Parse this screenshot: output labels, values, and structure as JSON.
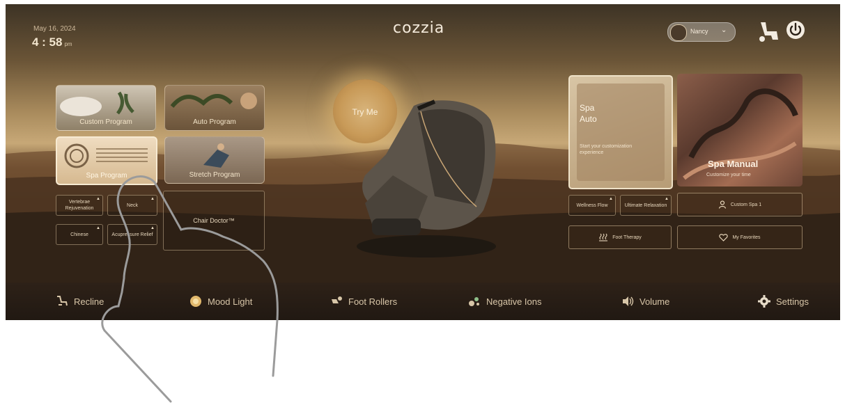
{
  "status": {
    "date": "May 16, 2024",
    "time": "4 : 58",
    "ampm": "pm"
  },
  "brand": {
    "logo_text": "cozzia"
  },
  "header": {
    "user_name": "Nancy",
    "chevron": "⌄"
  },
  "left_tiles": {
    "custom_program": "Custom Program",
    "auto_program": "Auto Program",
    "spa_program": "Spa Program",
    "stretch_program": "Stretch Program"
  },
  "left_buttons": {
    "vertebrae": "Vertebrae Rejuvenation",
    "neck": "Neck",
    "chinese": "Chinese",
    "acupressure": "Acupressure Relief",
    "chair_doctor": "Chair Doctor™"
  },
  "center": {
    "try_me": "Try Me"
  },
  "right_panel": {
    "spa_auto_title_1": "Spa",
    "spa_auto_title_2": "Auto",
    "spa_auto_desc": "Start your customization experience",
    "spa_manual_title": "Spa Manual",
    "spa_manual_desc": "Customize your time",
    "wellness_flow": "Wellness Flow",
    "ultimate_relaxation": "Ultimate Relaxation",
    "custom_spa": "Custom Spa 1",
    "foot_therapy": "Foot Therapy",
    "my_favorites": "My Favorites"
  },
  "bottom_bar": {
    "recline": "Recline",
    "mood_light": "Mood Light",
    "foot_rollers": "Foot Rollers",
    "negative_ions": "Negative Ions",
    "volume": "Volume",
    "settings": "Settings"
  },
  "icons": [
    "chair-settings-icon",
    "power-icon",
    "recline-icon",
    "mood-light-icon",
    "foot-rollers-icon",
    "negative-ions-icon",
    "volume-icon",
    "settings-icon",
    "person-icon",
    "heart-icon",
    "heat-icon",
    "hand-pointer-icon"
  ],
  "colors": {
    "accent_gold": "#c89a58",
    "text_cream": "#f3e4c9",
    "bar_dark": "#201812"
  }
}
